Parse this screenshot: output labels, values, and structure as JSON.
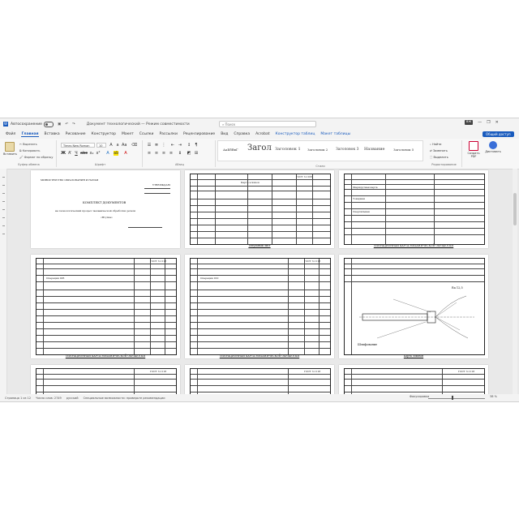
{
  "titlebar": {
    "logo": "W",
    "autosave": "Автосохранение",
    "doc_title": "Документ технологический — Режим совместимости",
    "search_placeholder": "Поиск",
    "min": "—",
    "restore": "❐",
    "close": "✕"
  },
  "tabs": [
    "Файл",
    "Главная",
    "Вставка",
    "Рисование",
    "Конструктор",
    "Макет",
    "Ссылки",
    "Рассылки",
    "Рецензирование",
    "Вид",
    "Справка",
    "Acrobat",
    "Конструктор таблиц",
    "Макет таблицы"
  ],
  "share_label": "Общий доступ",
  "ribbon": {
    "paste_label": "Вставить",
    "clipboard_label": "Буфер обмена",
    "cut_label": "Вырезать",
    "copy_label": "Копировать",
    "format_painter_label": "Формат по образцу",
    "font_name": "Times New Roman",
    "font_size": "10",
    "font_label": "Шрифт",
    "paragraph_label": "Абзац",
    "styles": [
      {
        "label": "АаБбВвГ",
        "size": "4px"
      },
      {
        "label": "Загол",
        "size": "10px"
      },
      {
        "label": "Заголовок 1",
        "size": "5px"
      },
      {
        "label": "Заголовок 2",
        "size": "4px"
      },
      {
        "label": "Заголовок 3",
        "size": "4.5px"
      },
      {
        "label": "Название",
        "size": "5px"
      },
      {
        "label": "Заголовок 5",
        "size": "4px"
      }
    ],
    "styles_label": "Стили",
    "find_label": "Найти",
    "replace_label": "Заменить",
    "select_label": "Выделить",
    "editing_label": "Редактирование",
    "acrobat_label": "Создать PDF",
    "dictate_label": "Диктовать"
  },
  "pages": [
    {
      "caption": "",
      "lines": [
        "МИНИСТЕРСТВО ОБРАЗОВАНИЯ И НАУКИ",
        "УТВЕРЖДАЮ",
        "КОМПЛЕКТ ДОКУМЕНТОВ",
        "на технологический процесс механической обработки детали",
        "«Втулка»"
      ]
    },
    {
      "caption": "Титульный лист",
      "lines": [
        "Карта эскизов",
        "ГОСТ 3.1105"
      ]
    },
    {
      "caption": "ОПЕРАЦИОННАЯ КАРТА МЕХАНИЧЕСКОЙ ОБРАБОТКИ",
      "lines": [
        "Маршрутная карта",
        "Токарная",
        "Сверлильная"
      ]
    },
    {
      "caption": "ОПЕРАЦИОННАЯ КАРТА МЕХАНИЧЕСКОЙ ОБРАБОТКИ",
      "lines": [
        "ГОСТ 3.1118",
        "Операция 005"
      ]
    },
    {
      "caption": "ОПЕРАЦИОННАЯ КАРТА МЕХАНИЧЕСКОЙ ОБРАБОТКИ",
      "lines": [
        "ГОСТ 3.1118",
        "Операция 010"
      ]
    },
    {
      "caption": "Карта эскизов",
      "lines": [
        "Ra 12,5",
        "Шлифование"
      ]
    },
    {
      "caption": "",
      "lines": [
        "ГОСТ 3.1118"
      ]
    },
    {
      "caption": "",
      "lines": [
        "ГОСТ 3.1118"
      ]
    },
    {
      "caption": "",
      "lines": [
        "ГОСТ 3.1118"
      ]
    }
  ],
  "status": {
    "page": "Страница 1 из 12",
    "words": "Число слов: 2749",
    "language": "русский",
    "accessibility": "Специальные возможности: проверьте рекомендации",
    "focus": "Фокусировка",
    "zoom": "38 %"
  }
}
